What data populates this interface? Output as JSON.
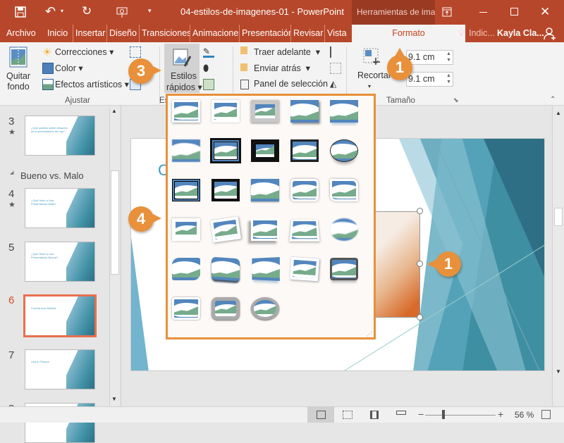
{
  "titlebar": {
    "title": "04-estilos-de-imagenes-01 - PowerPoint",
    "context_tools": "Herramientas de imag",
    "icons": [
      "save-icon",
      "undo-icon",
      "redo-icon",
      "start-presentation-icon",
      "customize-qat-icon",
      "ribbon-display-icon",
      "minimize-icon",
      "maximize-icon",
      "close-icon"
    ]
  },
  "tabs": [
    "Archivo",
    "Inicio",
    "Insertar",
    "Diseño",
    "Transiciones",
    "Animaciones",
    "Presentación",
    "Revisar",
    "Vista"
  ],
  "active_tab": "Formato",
  "tellme": "Indic...",
  "user": "Kayla Cla...",
  "ribbon": {
    "quitar_fondo": "Quitar\nfondo",
    "correcciones": "Correcciones",
    "color": "Color",
    "efectos": "Efectos artísticos",
    "ajustar": "Ajustar",
    "estilos_group": "Es",
    "estilos_rapidos_1": "Estilos",
    "estilos_rapidos_2": "rápidos",
    "traer": "Traer adelante",
    "enviar": "Enviar atrás",
    "panel": "Panel de selección",
    "recortar": "Recortar",
    "height": "9.1 cm",
    "width": "9.1 cm",
    "tamano": "Tamaño"
  },
  "slides": [
    {
      "num": "3",
      "star": "★",
      "title": "¿Qué quieres saber después de la presentación de hoy?"
    },
    {
      "num": "4",
      "star": "★",
      "title": "¿Qué Hace a Una Presentación Mala?"
    },
    {
      "num": "5",
      "star": "",
      "title": "¿Qué Hace a Una Presentación Buena?"
    },
    {
      "num": "6",
      "star": "",
      "title": "Cuenta una Historia"
    },
    {
      "num": "7",
      "star": "",
      "title": "Usa tu Tiempo"
    },
    {
      "num": "8",
      "star": "",
      "title": ""
    }
  ],
  "section": "Bueno vs. Malo",
  "selected_slide": "6",
  "slide_title_partial": "C",
  "gallery_styles": [
    "simple-frame-white",
    "soft-edge-white",
    "thick-matte-gray",
    "drop-shadow",
    "reflected",
    "soft-edge",
    "double-frame-black",
    "thick-matte-black",
    "simple-frame-black",
    "oval-shadow",
    "compound-frame-black",
    "black-frame",
    "beveled-matte",
    "rounded-white",
    "snip-corner",
    "center-shadow",
    "rotated-white",
    "perspective-shadow",
    "relaxed-perspective",
    "soft-edge-oval",
    "rounded-diagonal",
    "bevel-perspective",
    "perspective-reflection",
    "rotated-frame",
    "metal-frame",
    "reflected-rounded",
    "metal-rounded",
    "metal-oval"
  ],
  "callouts": {
    "a": "1",
    "b": "3",
    "c": "4",
    "d": "1"
  },
  "status": {
    "zoom": "56 %",
    "icons": [
      "normal-view-icon",
      "slide-sorter-icon",
      "reading-view-icon",
      "slideshow-icon",
      "zoom-out-icon",
      "zoom-in-icon",
      "fit-slide-icon"
    ],
    "zoom_percent": 56
  },
  "colors": {
    "accent": "#b7472a",
    "callout": "#e8903a"
  }
}
